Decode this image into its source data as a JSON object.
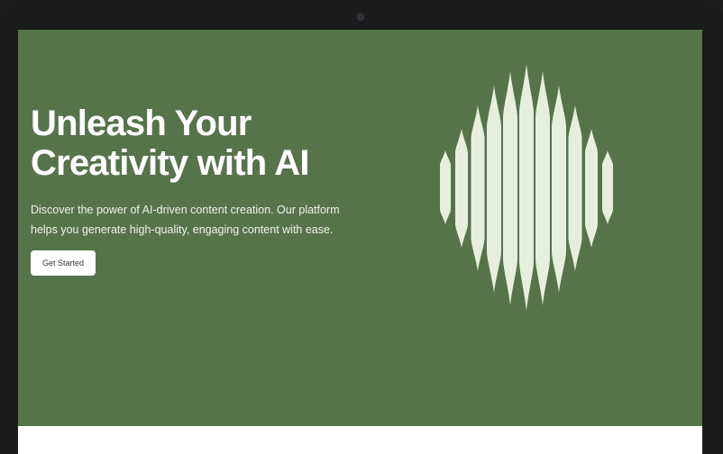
{
  "hero": {
    "headline_line1": "Unleash Your",
    "headline_line2": "Creativity with AI",
    "subtext": "Discover the power of AI-driven content creation. Our platform helps you generate high-quality, engaging content with ease.",
    "cta_label": "Get Started"
  },
  "graphic": {
    "icon": "waveform-bars-icon",
    "bar_color": "#e6efdc"
  },
  "colors": {
    "hero_background": "#56744a",
    "text": "#ffffff",
    "button_background": "#ffffff",
    "device_frame": "#1a1b1c"
  }
}
